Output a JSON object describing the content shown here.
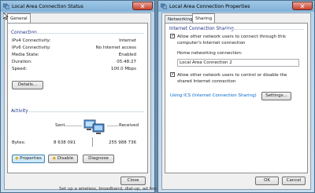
{
  "status_window": {
    "title": "Local Area Connection Status",
    "tab_general": "General",
    "connection": {
      "heading": "Connection",
      "rows": [
        {
          "label": "IPv4 Connectivity:",
          "value": "Internet"
        },
        {
          "label": "IPv6 Connectivity:",
          "value": "No Internet access"
        },
        {
          "label": "Media State:",
          "value": "Enabled"
        },
        {
          "label": "Duration:",
          "value": "05:48:27"
        },
        {
          "label": "Speed:",
          "value": "100.0 Mbps"
        }
      ],
      "details_button": "Details..."
    },
    "activity": {
      "heading": "Activity",
      "sent_label": "Sent",
      "received_label": "Received",
      "bytes_label": "Bytes:",
      "bytes_sent": "8 638 091",
      "bytes_received": "255 988 736"
    },
    "buttons": {
      "properties": "Properties",
      "disable": "Disable",
      "diagnose": "Diagnose",
      "close": "Close"
    }
  },
  "properties_window": {
    "title": "Local Area Connection Properties",
    "tabs": [
      "Networking",
      "Sharing"
    ],
    "ics": {
      "heading": "Internet Connection Sharing",
      "allow_connect": "Allow other network users to connect through this computer's Internet connection",
      "home_label": "Home networking connection:",
      "home_value": "Local Area Connection 2",
      "allow_control": "Allow other network users to control or disable the shared Internet connection",
      "link": "Using ICS (Internet Connection Sharing)",
      "settings_button": "Settings..."
    },
    "buttons": {
      "ok": "OK",
      "cancel": "Cancel"
    }
  },
  "background_text": "Set up a wireless, broadband, dial-up, ad hoc"
}
